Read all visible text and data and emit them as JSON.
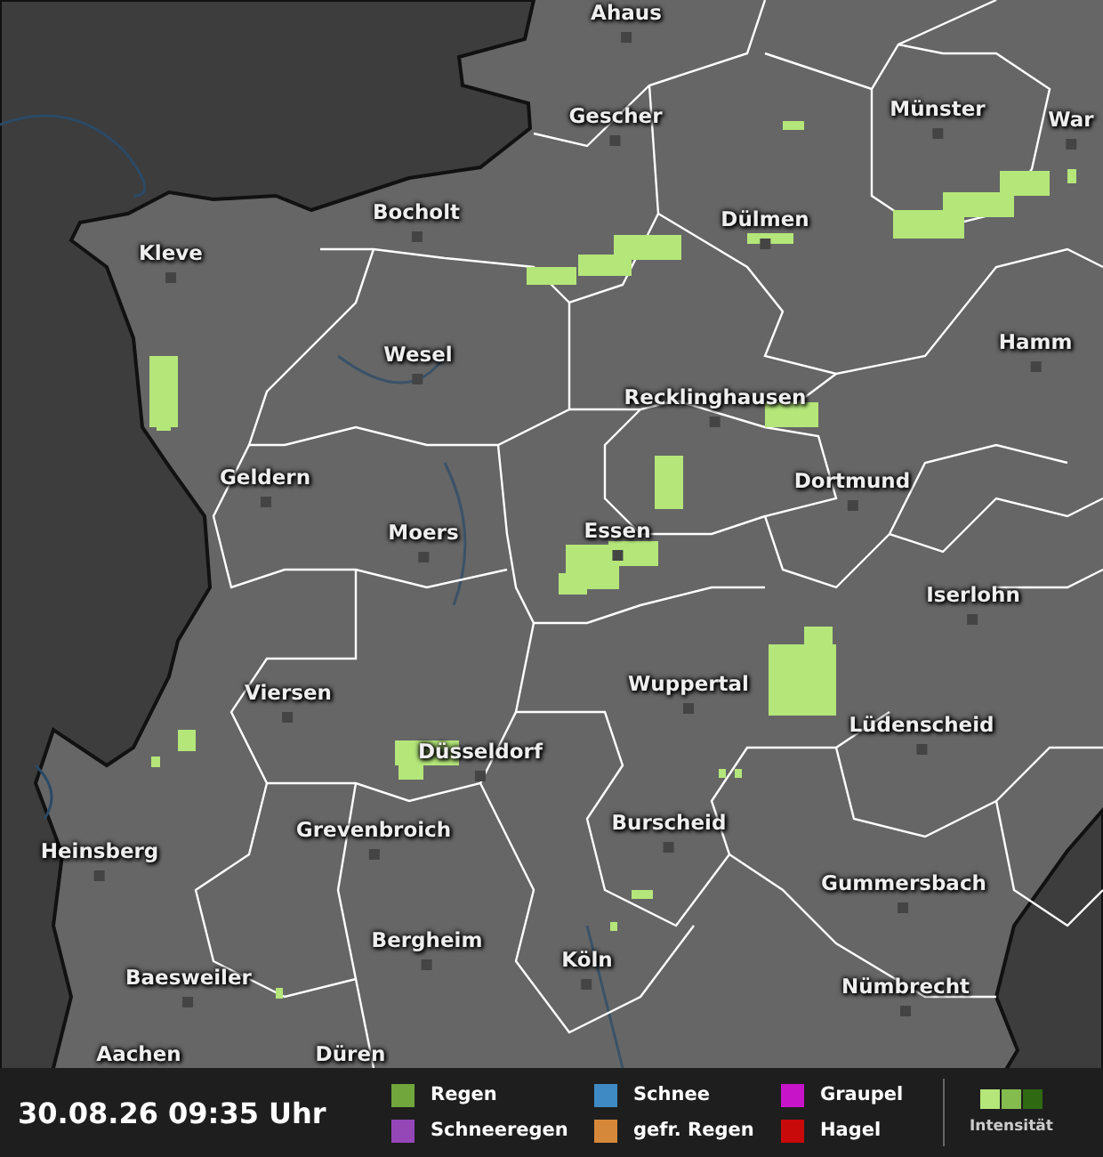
{
  "map": {
    "cities": [
      {
        "name": "Ahaus"
      },
      {
        "name": "Gescher"
      },
      {
        "name": "Münster"
      },
      {
        "name": "War"
      },
      {
        "name": "Bocholt"
      },
      {
        "name": "Dülmen"
      },
      {
        "name": "Kleve"
      },
      {
        "name": "Hamm"
      },
      {
        "name": "Wesel"
      },
      {
        "name": "Recklinghausen"
      },
      {
        "name": "Geldern"
      },
      {
        "name": "Dortmund"
      },
      {
        "name": "Moers"
      },
      {
        "name": "Essen"
      },
      {
        "name": "Iserlohn"
      },
      {
        "name": "Viersen"
      },
      {
        "name": "Wuppertal"
      },
      {
        "name": "Lüdenscheid"
      },
      {
        "name": "Düsseldorf"
      },
      {
        "name": "Grevenbroich"
      },
      {
        "name": "Burscheid"
      },
      {
        "name": "Heinsberg"
      },
      {
        "name": "Gummersbach"
      },
      {
        "name": "Bergheim"
      },
      {
        "name": "Köln"
      },
      {
        "name": "Baesweiler"
      },
      {
        "name": "Nümbrecht"
      },
      {
        "name": "Düren"
      },
      {
        "name": "Aachen"
      }
    ]
  },
  "legend": {
    "timestamp": "30.08.26 09:35 Uhr",
    "items": [
      {
        "label": "Regen",
        "color": "#70a63c"
      },
      {
        "label": "Schneeregen",
        "color": "#9547b8"
      },
      {
        "label": "Schnee",
        "color": "#3f8ac4"
      },
      {
        "label": "gefr. Regen",
        "color": "#d5883a"
      },
      {
        "label": "Graupel",
        "color": "#c814c8"
      },
      {
        "label": "Hagel",
        "color": "#c80a0a"
      }
    ],
    "intensity": {
      "label": "Intensität",
      "steps": [
        {
          "color": "#b4e67a"
        },
        {
          "color": "#84bc4e"
        },
        {
          "color": "#2f6a12"
        }
      ]
    }
  }
}
